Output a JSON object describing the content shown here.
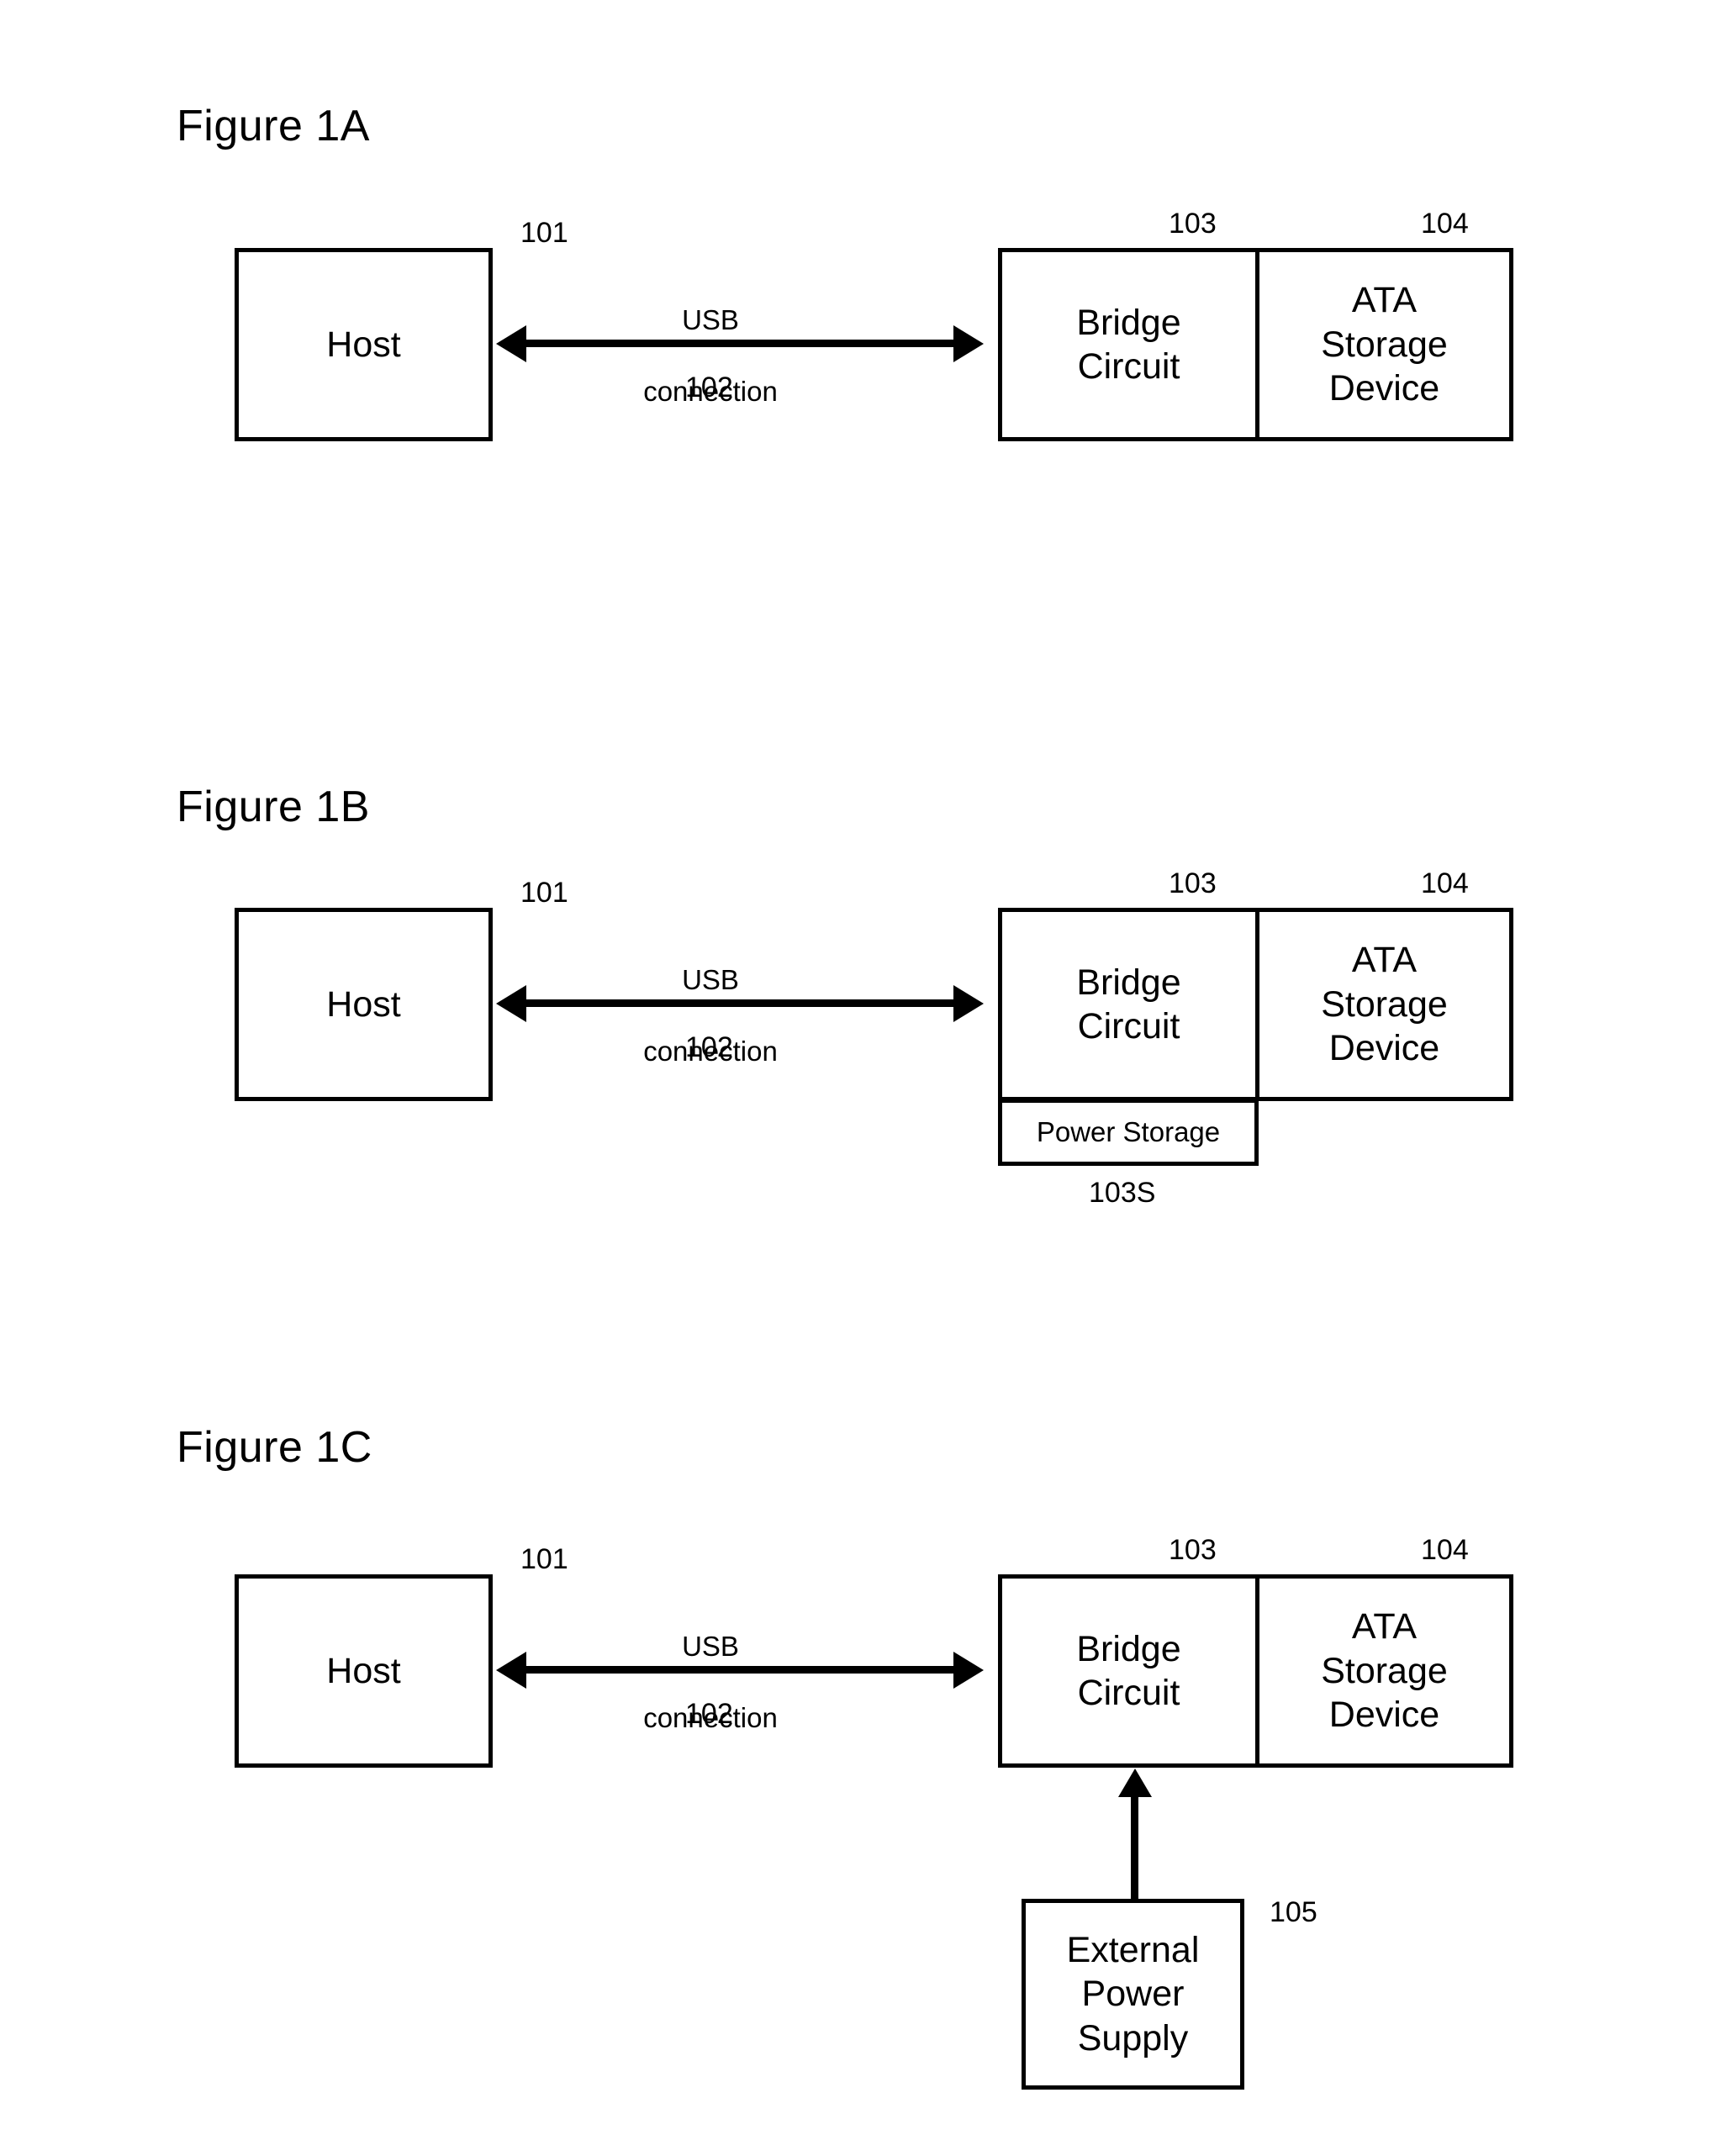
{
  "figures": [
    {
      "title": "Figure 1A",
      "host": {
        "label": "Host",
        "ref": "101"
      },
      "connection": {
        "line1": "USB",
        "line2": "connection",
        "ref": "102"
      },
      "bridge": {
        "label": "Bridge\nCircuit",
        "ref": "103"
      },
      "storage": {
        "label": "ATA\nStorage\nDevice",
        "ref": "104"
      }
    },
    {
      "title": "Figure 1B",
      "host": {
        "label": "Host",
        "ref": "101"
      },
      "connection": {
        "line1": "USB",
        "line2": "connection",
        "ref": "102"
      },
      "bridge": {
        "label": "Bridge\nCircuit",
        "ref": "103"
      },
      "storage": {
        "label": "ATA\nStorage\nDevice",
        "ref": "104"
      },
      "power_storage": {
        "label": "Power Storage",
        "ref": "103S"
      }
    },
    {
      "title": "Figure 1C",
      "host": {
        "label": "Host",
        "ref": "101"
      },
      "connection": {
        "line1": "USB",
        "line2": "connection",
        "ref": "102"
      },
      "bridge": {
        "label": "Bridge\nCircuit",
        "ref": "103"
      },
      "storage": {
        "label": "ATA\nStorage\nDevice",
        "ref": "104"
      },
      "external_power": {
        "label": "External\nPower\nSupply",
        "ref": "105"
      }
    }
  ]
}
